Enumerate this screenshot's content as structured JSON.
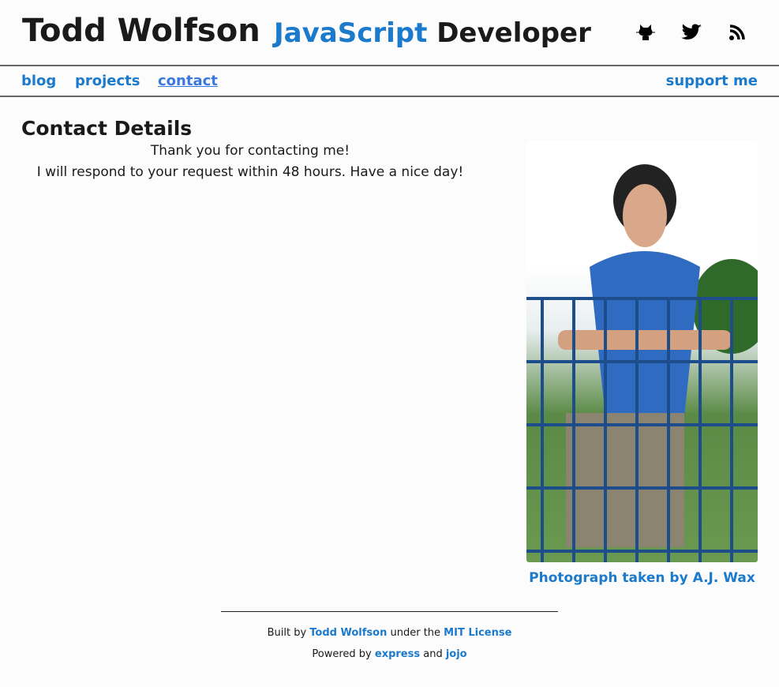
{
  "header": {
    "name": "Todd Wolfson",
    "tagline_accent": "JavaScript",
    "tagline_rest": "Developer",
    "icons": [
      "github-icon",
      "twitter-icon",
      "rss-icon"
    ]
  },
  "nav": {
    "items": [
      {
        "label": "blog"
      },
      {
        "label": "projects"
      },
      {
        "label": "contact"
      }
    ],
    "support": "support me"
  },
  "main": {
    "title": "Contact Details",
    "line1": "Thank you for contacting me!",
    "line2": "I will respond to your request within 48 hours. Have a nice day!"
  },
  "photo": {
    "caption": "Photograph taken by A.J. Wax"
  },
  "footer": {
    "built_by": "Built by",
    "author": "Todd Wolfson",
    "under": "under the",
    "license": "MIT License",
    "powered": "Powered by",
    "express": "express",
    "and": "and",
    "jojo": "jojo"
  },
  "colors": {
    "accent": "#1b7acb",
    "active": "#3a78e0"
  }
}
